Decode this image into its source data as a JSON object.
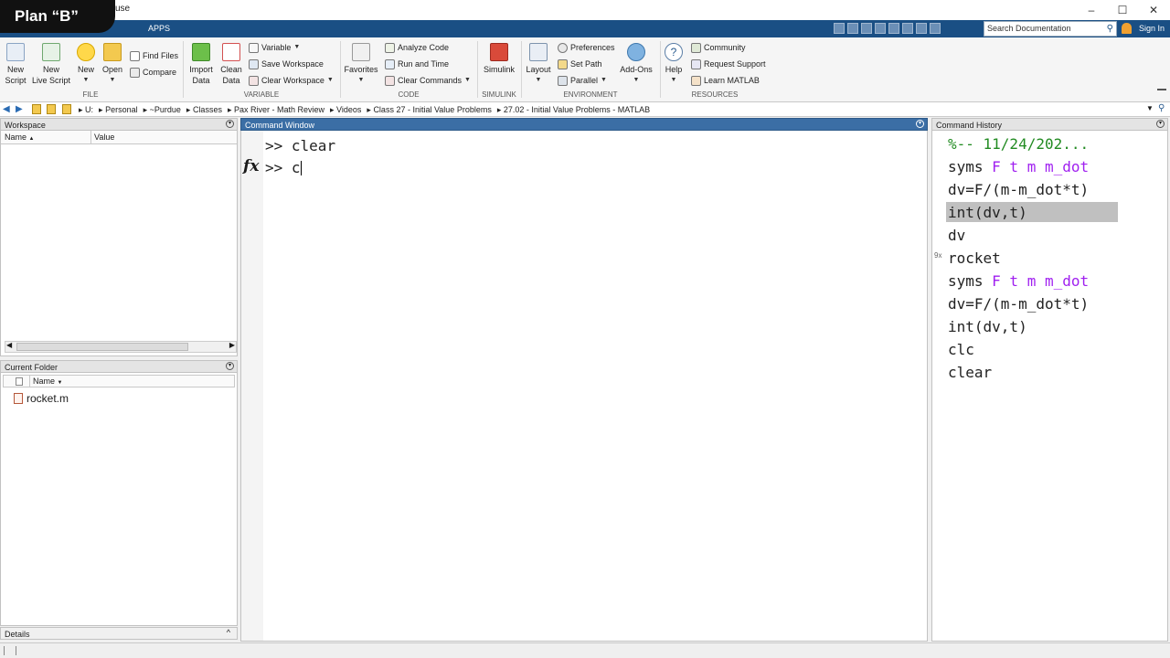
{
  "brand": {
    "logo_text": "Plan “B”"
  },
  "window": {
    "title_visible": "use"
  },
  "tabs": [
    {
      "label": "APPS"
    }
  ],
  "search": {
    "placeholder": "Search Documentation"
  },
  "account": {
    "sign_in": "Sign In"
  },
  "ribbon": {
    "file": {
      "new_script": [
        "New",
        "Script"
      ],
      "new_live_script": [
        "New",
        "Live Script"
      ],
      "new": "New",
      "open": "Open",
      "find_files": "Find Files",
      "compare": "Compare",
      "group_label": "FILE"
    },
    "variable": {
      "import_data": [
        "Import",
        "Data"
      ],
      "clean_data": [
        "Clean",
        "Data"
      ],
      "variable": "Variable",
      "save_workspace": "Save Workspace",
      "clear_workspace": "Clear Workspace",
      "group_label": "VARIABLE"
    },
    "code": {
      "favorites": "Favorites",
      "analyze_code": "Analyze Code",
      "run_and_time": "Run and Time",
      "clear_commands": "Clear Commands",
      "group_label": "CODE"
    },
    "simulink": {
      "simulink": "Simulink",
      "group_label": "SIMULINK"
    },
    "environment": {
      "layout": "Layout",
      "preferences": "Preferences",
      "set_path": "Set Path",
      "parallel": "Parallel",
      "add_ons": "Add-Ons",
      "group_label": "ENVIRONMENT"
    },
    "resources": {
      "help": "Help",
      "community": "Community",
      "request_support": "Request Support",
      "learn_matlab": "Learn MATLAB",
      "group_label": "RESOURCES"
    }
  },
  "address": {
    "path": [
      "U:",
      "Personal",
      "~Purdue",
      "Classes",
      "Pax River - Math Review",
      "Videos",
      "Class 27 - Initial Value Problems",
      "27.02 - Initial Value Problems - MATLAB"
    ]
  },
  "workspace": {
    "title": "Workspace",
    "columns": [
      "Name",
      "Value"
    ],
    "sort_indicator": "▲"
  },
  "current_folder": {
    "title": "Current Folder",
    "column": "Name",
    "sort_indicator": "▼",
    "files": [
      "rocket.m"
    ]
  },
  "details": {
    "title": "Details"
  },
  "command_window": {
    "title": "Command Window",
    "fx": "fx",
    "lines": [
      {
        "prompt": ">>",
        "text": "clear"
      },
      {
        "prompt": ">>",
        "text": "c"
      }
    ]
  },
  "command_history": {
    "title": "Command History",
    "badge": "9x",
    "entries": [
      {
        "plain": "",
        "comment": "%-- 11/24/202..."
      },
      {
        "head": "syms",
        "args": " F t m m_dot"
      },
      {
        "plain": "dv=F/(m-m_dot*t)"
      },
      {
        "plain": "int(dv,t)",
        "selected": true
      },
      {
        "plain": "dv"
      },
      {
        "plain": "rocket"
      },
      {
        "head": "syms",
        "args": " F t m m_dot"
      },
      {
        "plain": "dv=F/(m-m_dot*t)"
      },
      {
        "plain": "int(dv,t)"
      },
      {
        "plain": "clc"
      },
      {
        "plain": "clear"
      }
    ]
  },
  "colors": {
    "tab_strip": "#1a4f84",
    "command_header": "#3b6ea5",
    "history_highlight": "#c0c0c0",
    "keyword": "#a020f0",
    "comment": "#228b22"
  }
}
